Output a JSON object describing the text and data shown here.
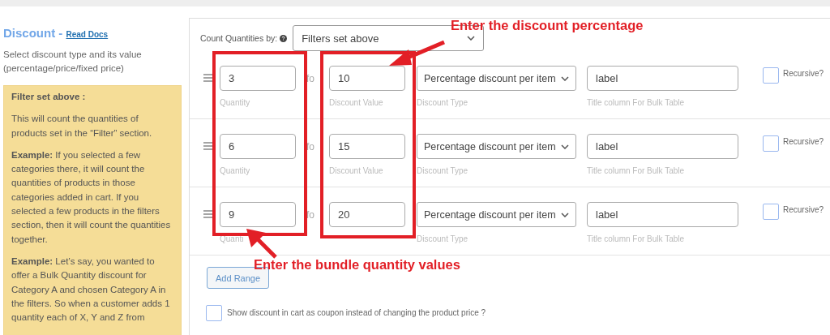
{
  "sidebar": {
    "title": "Discount - ",
    "docs_link": "Read Docs",
    "description": "Select discount type and its value (percentage/price/fixed price)",
    "help": {
      "heading": "Filter set above :",
      "paragraphs": [
        "This will count the quantities of products set in the “Filter” section.",
        "**Example:** If you selected a few categories there, it will count the quantities of products in those categories added in cart. If you selected a few products in the filters section, then it will count the quantities together.",
        "**Example:** Let’s say, you wanted to offer a Bulk Quantity discount for Category A and chosen Category A in the filters. So when a customer adds 1 quantity each of X, Y and Z from"
      ]
    }
  },
  "count_by": {
    "label": "Count Quantities by:",
    "value": "Filters set above"
  },
  "ranges": [
    {
      "quantity": "3",
      "quantity_label": "Quantity",
      "for": "fo",
      "discount_value": "10",
      "discount_value_label": "Discount Value",
      "discount_type": "Percentage discount per item",
      "discount_type_label": "Discount Type",
      "title": "label",
      "title_label": "Title column For Bulk Table",
      "recursive_label": "Recursive?",
      "recursive": false
    },
    {
      "quantity": "6",
      "quantity_label": "Quantity",
      "for": "fo",
      "discount_value": "15",
      "discount_value_label": "Discount Value",
      "discount_type": "Percentage discount per item",
      "discount_type_label": "Discount Type",
      "title": "label",
      "title_label": "Title column For Bulk Table",
      "recursive_label": "Recursive?",
      "recursive": false
    },
    {
      "quantity": "9",
      "quantity_label": "Quanti",
      "for": "fo",
      "discount_value": "20",
      "discount_type": "Percentage discount per item",
      "discount_type_label": "Discount Type",
      "title": "label",
      "title_label": "Title column For Bulk Table",
      "recursive_label": "Recursive?",
      "recursive": false
    }
  ],
  "add_range_button": "Add Range",
  "coupon_option": {
    "label": "Show discount in cart as coupon instead of changing the product price ?",
    "checked": false
  },
  "annotations": [
    {
      "kind": "top",
      "text": "Enter the discount percentage"
    },
    {
      "kind": "bottom",
      "text": "Enter the bundle quantity values"
    }
  ]
}
